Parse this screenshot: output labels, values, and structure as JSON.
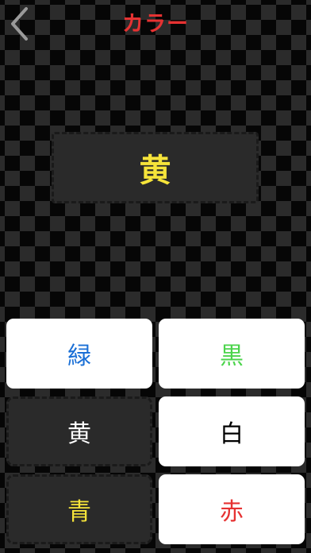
{
  "header": {
    "title": "カラー",
    "back_icon": "chevron-left-icon"
  },
  "question": {
    "word": "黄",
    "color": "#f6e43a"
  },
  "answers": [
    {
      "label": "緑",
      "color": "#1a6fd6",
      "style": "light"
    },
    {
      "label": "黒",
      "color": "#4cd44c",
      "style": "light"
    },
    {
      "label": "黄",
      "color": "#ffffff",
      "style": "dark"
    },
    {
      "label": "白",
      "color": "#000000",
      "style": "light"
    },
    {
      "label": "青",
      "color": "#f6e43a",
      "style": "dark"
    },
    {
      "label": "赤",
      "color": "#e63232",
      "style": "light"
    }
  ],
  "colors": {
    "title": "#e63232",
    "background_dark": "#060606",
    "background_tile": "#2c2c2c",
    "panel": "#2a2a2a"
  }
}
